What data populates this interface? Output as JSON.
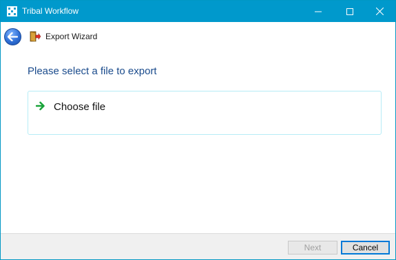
{
  "window": {
    "title": "Tribal Workflow",
    "accent_color": "#0099cc",
    "controls": [
      "minimize-icon",
      "maximize-icon",
      "close-icon"
    ]
  },
  "nav": {
    "back_icon": "back-arrow-icon",
    "wizard_icon": "export-door-icon",
    "wizard_title": "Export Wizard"
  },
  "content": {
    "prompt": "Please select a file to export",
    "prompt_color": "#1a4b8c",
    "choice": {
      "icon": "green-arrow-right-icon",
      "label": "Choose file"
    }
  },
  "footer": {
    "next_label": "Next",
    "next_disabled": true,
    "cancel_label": "Cancel"
  }
}
